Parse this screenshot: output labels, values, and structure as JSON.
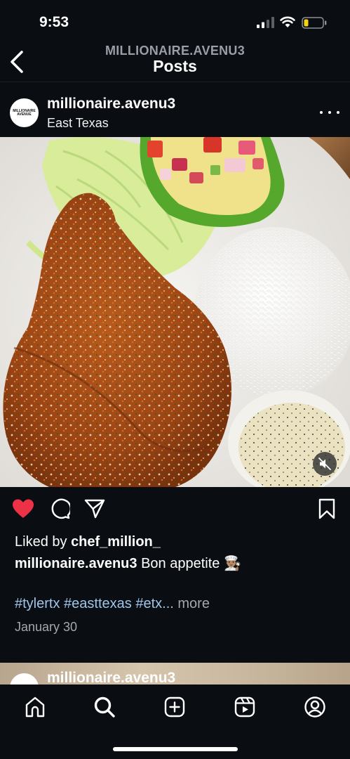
{
  "status_bar": {
    "time": "9:53"
  },
  "header": {
    "account": "MILLIONAIRE.AVENU3",
    "title": "Posts"
  },
  "post": {
    "username": "millionaire.avenu3",
    "location": "East Texas",
    "avatar_text_line1": "MILLIONAIRE",
    "avatar_text_line2": "AVENUE",
    "liked_prefix": "Liked by ",
    "liked_user": "chef_million_",
    "caption_user": "millionaire.avenu3",
    "caption_text": " Bon appetite 👨🏽‍🍳",
    "hashtags": [
      "#tylertx",
      "#easttexas",
      "#etx..."
    ],
    "more_label": "more",
    "date": "January 30",
    "liked": true
  },
  "next_post": {
    "username": "millionaire.avenu3"
  },
  "tab_bar": {
    "items": [
      "home-icon",
      "search-icon",
      "create-icon",
      "reels-icon",
      "profile-icon"
    ]
  },
  "colors": {
    "background": "#0a0d12",
    "like_red": "#ed3146",
    "hashtag_blue": "#9fc6ea",
    "muted_text": "#a5a8ae"
  }
}
